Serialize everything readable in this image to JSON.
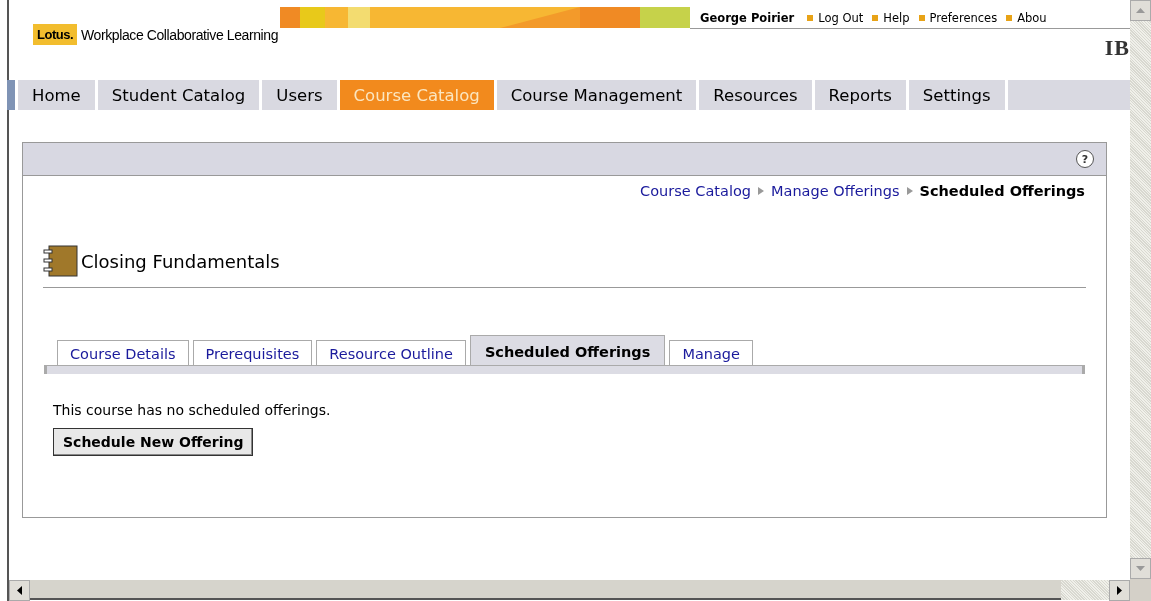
{
  "header": {
    "brand": "Lotus.",
    "product": "Workplace Collaborative Learning",
    "user": "George Poirier",
    "links": [
      "Log Out",
      "Help",
      "Preferences",
      "Abou"
    ],
    "vendor": "IB"
  },
  "nav": [
    {
      "label": "Home",
      "selected": false
    },
    {
      "label": "Student Catalog",
      "selected": false
    },
    {
      "label": "Users",
      "selected": false
    },
    {
      "label": "Course Catalog",
      "selected": true
    },
    {
      "label": "Course Management",
      "selected": false
    },
    {
      "label": "Resources",
      "selected": false
    },
    {
      "label": "Reports",
      "selected": false
    },
    {
      "label": "Settings",
      "selected": false
    }
  ],
  "panel": {
    "help": "?",
    "breadcrumb": [
      "Course Catalog",
      "Manage Offerings",
      "Scheduled Offerings"
    ],
    "title": "Closing Fundamentals",
    "tabs": [
      {
        "label": "Course Details",
        "selected": false
      },
      {
        "label": "Prerequisites",
        "selected": false
      },
      {
        "label": "Resource Outline",
        "selected": false
      },
      {
        "label": "Scheduled Offerings",
        "selected": true
      },
      {
        "label": "Manage",
        "selected": false
      }
    ],
    "message": "This course has no scheduled offerings.",
    "button": "Schedule New Offering"
  }
}
